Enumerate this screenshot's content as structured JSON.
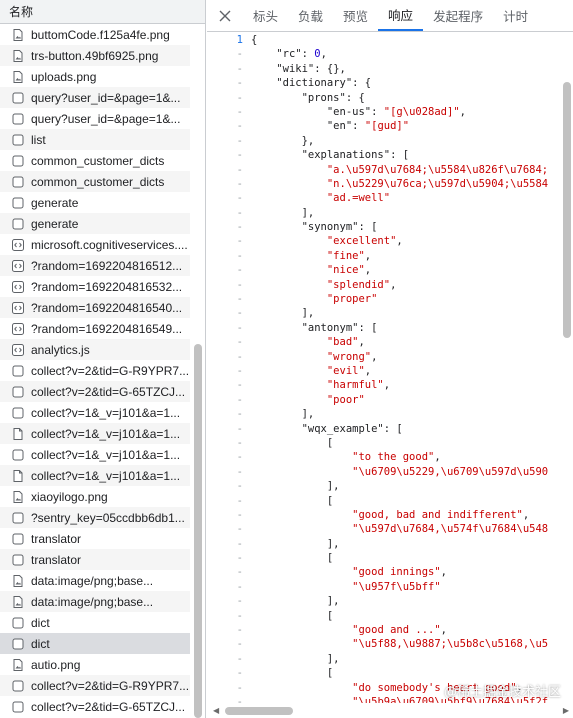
{
  "colors": {
    "accent": "#1a73e8",
    "string": "#c80000",
    "number": "#1c00cf",
    "selected_row": "#dadce0",
    "stripe": "#f5f5f5"
  },
  "list": {
    "header": "名称",
    "rows": [
      {
        "name": "buttomCode.f125a4fe.png",
        "icon": "image-file-icon"
      },
      {
        "name": "trs-button.49bf6925.png",
        "icon": "image-file-icon"
      },
      {
        "name": "uploads.png",
        "icon": "image-file-icon"
      },
      {
        "name": "query?user_id=&page=1&...",
        "icon": "fetch-request-icon"
      },
      {
        "name": "query?user_id=&page=1&...",
        "icon": "fetch-request-icon"
      },
      {
        "name": "list",
        "icon": "fetch-request-icon"
      },
      {
        "name": "common_customer_dicts",
        "icon": "fetch-request-icon"
      },
      {
        "name": "common_customer_dicts",
        "icon": "fetch-request-icon"
      },
      {
        "name": "generate",
        "icon": "fetch-request-icon"
      },
      {
        "name": "generate",
        "icon": "fetch-request-icon"
      },
      {
        "name": "microsoft.cognitiveservices....",
        "icon": "script-file-icon"
      },
      {
        "name": "?random=1692204816512...",
        "icon": "script-file-icon"
      },
      {
        "name": "?random=1692204816532...",
        "icon": "script-file-icon"
      },
      {
        "name": "?random=1692204816540...",
        "icon": "script-file-icon"
      },
      {
        "name": "?random=1692204816549...",
        "icon": "script-file-icon"
      },
      {
        "name": "analytics.js",
        "icon": "script-file-icon"
      },
      {
        "name": "collect?v=2&tid=G-R9YPR7...",
        "icon": "fetch-request-icon"
      },
      {
        "name": "collect?v=2&tid=G-65TZCJ...",
        "icon": "fetch-request-icon"
      },
      {
        "name": "collect?v=1&_v=j101&a=1...",
        "icon": "fetch-request-icon"
      },
      {
        "name": "collect?v=1&_v=j101&a=1...",
        "icon": "document-file-icon"
      },
      {
        "name": "collect?v=1&_v=j101&a=1...",
        "icon": "fetch-request-icon"
      },
      {
        "name": "collect?v=1&_v=j101&a=1...",
        "icon": "document-file-icon"
      },
      {
        "name": "xiaoyilogo.png",
        "icon": "image-file-icon"
      },
      {
        "name": "?sentry_key=05ccdbb6db1...",
        "icon": "fetch-request-icon"
      },
      {
        "name": "translator",
        "icon": "fetch-request-icon"
      },
      {
        "name": "translator",
        "icon": "fetch-request-icon"
      },
      {
        "name": "data:image/png;base...",
        "icon": "image-file-icon"
      },
      {
        "name": "data:image/png;base...",
        "icon": "image-file-icon"
      },
      {
        "name": "dict",
        "icon": "fetch-request-icon"
      },
      {
        "name": "dict",
        "icon": "fetch-request-icon",
        "selected": true
      },
      {
        "name": "autio.png",
        "icon": "image-file-icon"
      },
      {
        "name": "collect?v=2&tid=G-R9YPR7...",
        "icon": "fetch-request-icon"
      },
      {
        "name": "collect?v=2&tid=G-65TZCJ...",
        "icon": "fetch-request-icon"
      }
    ]
  },
  "tabs": {
    "close_label": "×",
    "items": [
      {
        "label": "标头",
        "active": false
      },
      {
        "label": "负载",
        "active": false
      },
      {
        "label": "预览",
        "active": false
      },
      {
        "label": "响应",
        "active": true
      },
      {
        "label": "发起程序",
        "active": false
      },
      {
        "label": "计时",
        "active": false
      }
    ]
  },
  "response": {
    "first_line_number": "1",
    "continuation_marker": "-",
    "lines": [
      "{",
      "    \"rc\": 0,",
      "    \"wiki\": {},",
      "    \"dictionary\": {",
      "        \"prons\": {",
      "            \"en-us\": \"[g\\u028ad]\",",
      "            \"en\": \"[gud]\"",
      "        },",
      "        \"explanations\": [",
      "            \"a.\\u597d\\u7684;\\u5584\\u826f\\u7684;",
      "            \"n.\\u5229\\u76ca;\\u597d\\u5904;\\u5584",
      "            \"ad.=well\"",
      "        ],",
      "        \"synonym\": [",
      "            \"excellent\",",
      "            \"fine\",",
      "            \"nice\",",
      "            \"splendid\",",
      "            \"proper\"",
      "        ],",
      "        \"antonym\": [",
      "            \"bad\",",
      "            \"wrong\",",
      "            \"evil\",",
      "            \"harmful\",",
      "            \"poor\"",
      "        ],",
      "        \"wqx_example\": [",
      "            [",
      "                \"to the good\",",
      "                \"\\u6709\\u5229,\\u6709\\u597d\\u590",
      "            ],",
      "            [",
      "                \"good, bad and indifferent\",",
      "                \"\\u597d\\u7684,\\u574f\\u7684\\u548",
      "            ],",
      "            [",
      "                \"good innings\",",
      "                \"\\u957f\\u5bff\"",
      "            ],",
      "            [",
      "                \"good and ...\",",
      "                \"\\u5f88,\\u9887;\\u5b8c\\u5168,\\u5",
      "            ],",
      "            [",
      "                \"do somebody's heart good\",",
      "                \"\\u5b9a\\u6709\\u5bf9\\u7684\\u5f2f"
    ]
  },
  "watermark": "@稀土掘金技术社区"
}
